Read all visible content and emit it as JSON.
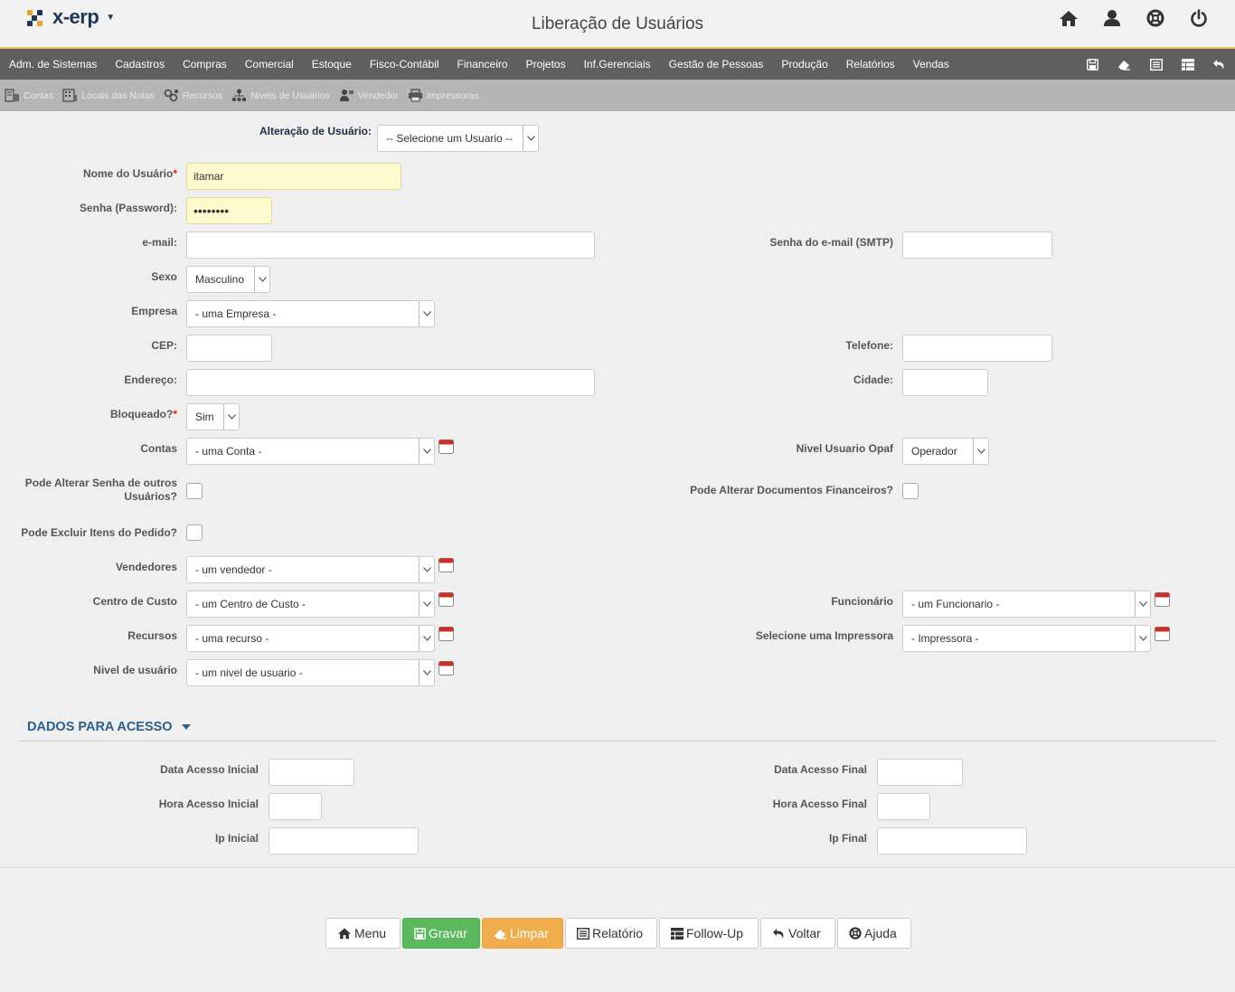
{
  "header": {
    "logo_text": "x-erp",
    "title": "Liberação de Usuários",
    "icons": [
      "home-icon",
      "user-icon",
      "lifebuoy-icon",
      "power-icon"
    ]
  },
  "main_nav": {
    "items": [
      "Adm. de Sistemas",
      "Cadastros",
      "Compras",
      "Comercial",
      "Estoque",
      "Fisco-Contábil",
      "Financeiro",
      "Projetos",
      "Inf.Gerenciais",
      "Gestão de Pessoas",
      "Produção",
      "Relatórios",
      "Vendas"
    ],
    "tools": [
      "save-icon",
      "eraser-icon",
      "report-icon",
      "table-icon",
      "back-icon"
    ]
  },
  "sub_nav": {
    "items": [
      "Contas",
      "Locais das Notas",
      "Recursos",
      "Niveis de Usuários",
      "Vendedor",
      "Impressoras"
    ]
  },
  "form": {
    "alteracao": {
      "label": "Alteração de Usuário:",
      "value": "-- Selecione um Usuario --"
    },
    "nome": {
      "label": "Nome do Usuário",
      "required": "*",
      "value": "itamar"
    },
    "senha": {
      "label": "Senha (Password):",
      "value": "••••••••"
    },
    "email": {
      "label": "e-mail:",
      "value": ""
    },
    "senha_email": {
      "label": "Senha do e-mail (SMTP)",
      "value": ""
    },
    "sexo": {
      "label": "Sexo",
      "value": "Masculino"
    },
    "empresa": {
      "label": "Empresa",
      "value": "- uma Empresa -"
    },
    "cep": {
      "label": "CEP:",
      "value": ""
    },
    "telefone": {
      "label": "Telefone:",
      "value": ""
    },
    "endereco": {
      "label": "Endereço:",
      "value": ""
    },
    "cidade": {
      "label": "Cidade:",
      "value": ""
    },
    "bloqueado": {
      "label": "Bloqueado?",
      "required": "*",
      "value": "Sim"
    },
    "contas": {
      "label": "Contas",
      "value": "- uma Conta -"
    },
    "nivel_opaf": {
      "label": "Nivel Usuario Opaf",
      "value": "Operador"
    },
    "pode_alterar_senha": {
      "label_line1": "Pode Alterar Senha de outros",
      "label_line2": "Usuários?"
    },
    "pode_alterar_docs": {
      "label": "Pode Alterar Documentos Financeiros?"
    },
    "pode_excluir": {
      "label": "Pode Excluir Itens do Pedido?"
    },
    "vendedores": {
      "label": "Vendedores",
      "value": "- um vendedor -"
    },
    "centro_custo": {
      "label": "Centro de Custo",
      "value": "- um Centro de Custo -"
    },
    "funcionario": {
      "label": "Funcionário",
      "value": "- um Funcionario -"
    },
    "recursos": {
      "label": "Recursos",
      "value": "- uma recurso -"
    },
    "impressora": {
      "label": "Selecione uma Impressora",
      "value": "- Impressora -"
    },
    "nivel_usuario": {
      "label": "Nivel de usuário",
      "value": "- um nivel de usuario -"
    }
  },
  "acesso": {
    "section_title": "DADOS PARA ACESSO",
    "data_inicial": "Data Acesso Inicial",
    "data_final": "Data Acesso Final",
    "hora_inicial": "Hora Acesso Inicial",
    "hora_final": "Hora Acesso Final",
    "ip_inicial": "Ip Inicial",
    "ip_final": "Ip Final"
  },
  "buttons": {
    "menu": "Menu",
    "gravar": "Gravar",
    "limpar": "Limpar",
    "relatorio": "Relatório",
    "followup": "Follow-Up",
    "voltar": "Voltar",
    "ajuda": "Ajuda"
  },
  "colors": {
    "nav_bg": "#5f5f5f",
    "subnav_bg": "#b5b5b5",
    "gravar": "#5cb85c",
    "limpar": "#f0ad4e",
    "section_title": "#2c5f8a",
    "required_input": "#fffacd"
  }
}
